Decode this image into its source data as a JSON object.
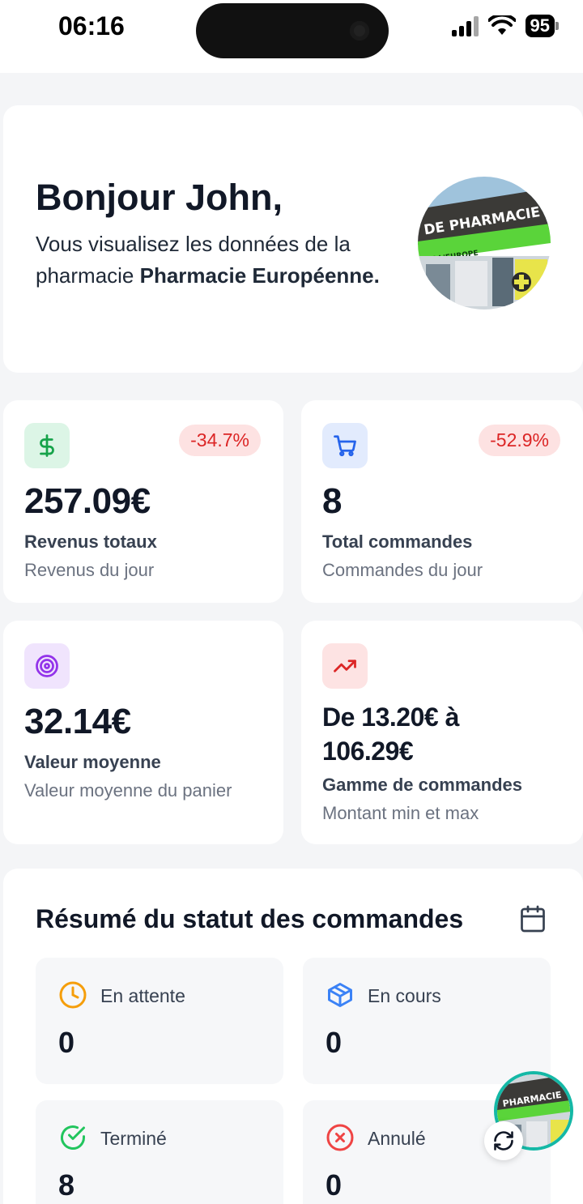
{
  "status_bar": {
    "time": "06:16",
    "battery": "95"
  },
  "greeting": {
    "title": "Bonjour John,",
    "text_prefix": "Vous visualisez les données de la pharmacie ",
    "pharmacy_name": "Pharmacie Européenne.",
    "photo_sign": "DE PHARMACIE",
    "photo_sub": "DE L'EUROPE"
  },
  "stats": [
    {
      "icon": "dollar-icon",
      "badge": "-34.7%",
      "value": "257.09€",
      "label": "Revenus totaux",
      "sub": "Revenus du jour"
    },
    {
      "icon": "cart-icon",
      "badge": "-52.9%",
      "value": "8",
      "label": "Total commandes",
      "sub": "Commandes du jour"
    },
    {
      "icon": "target-icon",
      "value": "32.14€",
      "label": "Valeur moyenne",
      "sub": "Valeur moyenne du panier"
    },
    {
      "icon": "trending-up-icon",
      "value_line1": "De 13.20€ à",
      "value_line2": "106.29€",
      "label": "Gamme de commandes",
      "sub": "Montant min et max"
    }
  ],
  "summary": {
    "title": "Résumé du statut des commandes",
    "items": [
      {
        "icon": "clock-icon",
        "label": "En attente",
        "value": "0"
      },
      {
        "icon": "box-icon",
        "label": "En cours",
        "value": "0"
      },
      {
        "icon": "check-circle-icon",
        "label": "Terminé",
        "value": "8"
      },
      {
        "icon": "x-circle-icon",
        "label": "Annulé",
        "value": "0"
      }
    ]
  },
  "colors": {
    "negative_badge_bg": "#fde2e2",
    "negative_badge_text": "#dc2626",
    "revenue_icon": "#16a34a",
    "orders_icon": "#2563eb",
    "average_icon": "#9333ea",
    "range_icon": "#dc2626"
  }
}
